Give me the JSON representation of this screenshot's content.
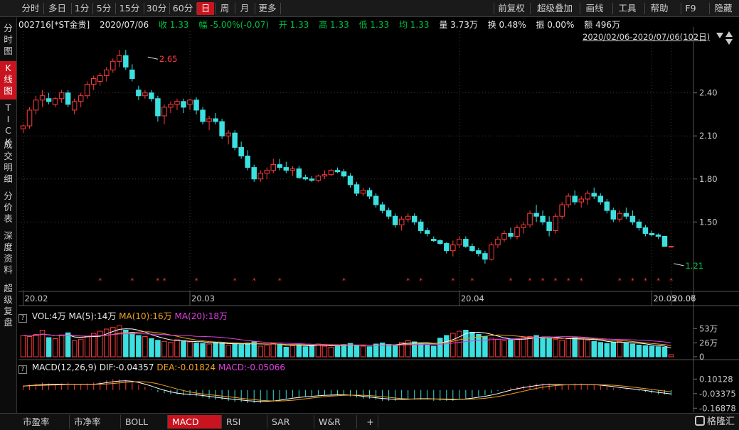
{
  "toolbar": {
    "left": [
      "分时",
      "多日",
      "1分",
      "5分",
      "15分",
      "30分",
      "60分",
      "日",
      "周",
      "月",
      "更多"
    ],
    "right": [
      "前复权",
      "超级叠加",
      "画线",
      "工具",
      "帮助",
      "F9",
      "隐藏"
    ]
  },
  "info": {
    "code": "002716[*ST金贵]",
    "date": "2020/07/06",
    "close": "收 1.33",
    "change": "幅 -5.00%(-0.07)",
    "open": "开 1.33",
    "high": "高 1.33",
    "low": "低 1.33",
    "avg": "均 1.33",
    "volume": "量 3.73万",
    "turnover": "换 0.48%",
    "amplitude": "振 0.00%",
    "amount": "额 496万"
  },
  "range_label": "2020/02/06-2020/07/06(102日)",
  "side_tabs": [
    "分时图",
    "K线图",
    "TICK",
    "成交明细",
    "分价表",
    "深度资料",
    "超级复盘"
  ],
  "vol_header": {
    "vol": "VOL:4万",
    "ma5": "MA(5):14万",
    "ma10": "MA(10):16万",
    "ma20": "MA(20):18万"
  },
  "macd_header": {
    "name": "MACD(12,26,9)",
    "dif": "DIF:-0.04357",
    "dea": "DEA:-0.01824",
    "macd": "MACD:-0.05066"
  },
  "bottom_tabs": [
    "市盈率",
    "市净率",
    "BOLL",
    "MACD",
    "RSI",
    "SAR",
    "W&R"
  ],
  "add_tab_label": "+",
  "logo_text": "格隆汇",
  "colors": {
    "up": "#ff3b3b",
    "down": "#3ce0e0",
    "ma5": "#ffffff",
    "ma10": "#f0a020",
    "ma20": "#e040e0",
    "grid": "#3a3a3a",
    "accent": "#c8141e"
  },
  "chart_data": [
    {
      "type": "candlestick",
      "x_tick_labels": [
        "20.02",
        "20.03",
        "20.04",
        "20.05",
        "20.06",
        "20.07"
      ],
      "y_tick_labels": [
        "2.40",
        "2.10",
        "1.80",
        "1.50"
      ],
      "y_ticks": [
        2.4,
        2.1,
        1.8,
        1.5
      ],
      "ylim": [
        1.12,
        2.78
      ],
      "grid": true,
      "annotations": [
        {
          "label": "2.65",
          "value": 2.65,
          "day": 19
        },
        {
          "label": "1.21",
          "value": 1.21,
          "day": 106
        }
      ],
      "tick_days": [
        0,
        26,
        68,
        98,
        125,
        157
      ],
      "ohlc": [
        [
          2.15,
          2.18,
          2.12,
          2.17
        ],
        [
          2.17,
          2.3,
          2.15,
          2.28
        ],
        [
          2.28,
          2.38,
          2.25,
          2.35
        ],
        [
          2.35,
          2.42,
          2.3,
          2.38
        ],
        [
          2.36,
          2.4,
          2.32,
          2.34
        ],
        [
          2.32,
          2.37,
          2.3,
          2.36
        ],
        [
          2.36,
          2.42,
          2.33,
          2.4
        ],
        [
          2.4,
          2.42,
          2.3,
          2.32
        ],
        [
          2.28,
          2.36,
          2.25,
          2.34
        ],
        [
          2.34,
          2.4,
          2.3,
          2.38
        ],
        [
          2.38,
          2.48,
          2.36,
          2.46
        ],
        [
          2.46,
          2.52,
          2.42,
          2.5
        ],
        [
          2.48,
          2.54,
          2.45,
          2.52
        ],
        [
          2.52,
          2.58,
          2.48,
          2.56
        ],
        [
          2.56,
          2.64,
          2.54,
          2.62
        ],
        [
          2.62,
          2.7,
          2.58,
          2.66
        ],
        [
          2.66,
          2.7,
          2.56,
          2.58
        ],
        [
          2.56,
          2.6,
          2.48,
          2.5
        ],
        [
          2.42,
          2.45,
          2.35,
          2.38
        ],
        [
          2.38,
          2.42,
          2.36,
          2.4
        ],
        [
          2.4,
          2.42,
          2.34,
          2.36
        ],
        [
          2.36,
          2.38,
          2.2,
          2.24
        ],
        [
          2.24,
          2.32,
          2.18,
          2.3
        ],
        [
          2.3,
          2.34,
          2.26,
          2.32
        ],
        [
          2.32,
          2.36,
          2.28,
          2.34
        ],
        [
          2.34,
          2.36,
          2.26,
          2.3
        ],
        [
          2.32,
          2.36,
          2.28,
          2.35
        ],
        [
          2.35,
          2.37,
          2.25,
          2.28
        ],
        [
          2.28,
          2.3,
          2.18,
          2.2
        ],
        [
          2.2,
          2.24,
          2.14,
          2.22
        ],
        [
          2.22,
          2.26,
          2.18,
          2.2
        ],
        [
          2.2,
          2.22,
          2.08,
          2.1
        ],
        [
          2.1,
          2.14,
          2.04,
          2.12
        ],
        [
          2.12,
          2.14,
          2.0,
          2.02
        ],
        [
          2.02,
          2.06,
          1.94,
          1.96
        ],
        [
          1.96,
          2.0,
          1.86,
          1.88
        ],
        [
          1.88,
          1.9,
          1.78,
          1.8
        ],
        [
          1.8,
          1.86,
          1.78,
          1.84
        ],
        [
          1.84,
          1.88,
          1.8,
          1.86
        ],
        [
          1.86,
          1.94,
          1.84,
          1.9
        ],
        [
          1.9,
          1.94,
          1.86,
          1.88
        ],
        [
          1.88,
          1.92,
          1.84,
          1.86
        ],
        [
          1.86,
          1.89,
          1.82,
          1.87
        ],
        [
          1.87,
          1.89,
          1.8,
          1.81
        ],
        [
          1.81,
          1.83,
          1.79,
          1.8
        ],
        [
          1.8,
          1.82,
          1.78,
          1.79
        ],
        [
          1.79,
          1.83,
          1.78,
          1.82
        ],
        [
          1.82,
          1.86,
          1.8,
          1.83
        ],
        [
          1.83,
          1.87,
          1.82,
          1.86
        ],
        [
          1.86,
          1.88,
          1.84,
          1.85
        ],
        [
          1.85,
          1.87,
          1.81,
          1.82
        ],
        [
          1.82,
          1.84,
          1.74,
          1.76
        ],
        [
          1.76,
          1.78,
          1.68,
          1.7
        ],
        [
          1.7,
          1.74,
          1.68,
          1.72
        ],
        [
          1.72,
          1.74,
          1.66,
          1.68
        ],
        [
          1.68,
          1.7,
          1.6,
          1.62
        ],
        [
          1.62,
          1.64,
          1.56,
          1.58
        ],
        [
          1.58,
          1.6,
          1.52,
          1.54
        ],
        [
          1.54,
          1.56,
          1.46,
          1.48
        ],
        [
          1.48,
          1.54,
          1.44,
          1.52
        ],
        [
          1.52,
          1.56,
          1.5,
          1.54
        ],
        [
          1.54,
          1.56,
          1.48,
          1.5
        ],
        [
          1.5,
          1.52,
          1.42,
          1.44
        ],
        [
          1.44,
          1.46,
          1.4,
          1.42
        ],
        [
          1.38,
          1.4,
          1.36,
          1.37
        ],
        [
          1.37,
          1.38,
          1.34,
          1.35
        ],
        [
          1.35,
          1.36,
          1.28,
          1.3
        ],
        [
          1.3,
          1.37,
          1.26,
          1.34
        ],
        [
          1.34,
          1.4,
          1.32,
          1.38
        ],
        [
          1.38,
          1.4,
          1.32,
          1.33
        ],
        [
          1.33,
          1.35,
          1.29,
          1.3
        ],
        [
          1.3,
          1.32,
          1.26,
          1.28
        ],
        [
          1.28,
          1.3,
          1.21,
          1.24
        ],
        [
          1.24,
          1.36,
          1.23,
          1.34
        ],
        [
          1.34,
          1.4,
          1.32,
          1.38
        ],
        [
          1.38,
          1.44,
          1.36,
          1.42
        ],
        [
          1.42,
          1.46,
          1.38,
          1.4
        ],
        [
          1.4,
          1.48,
          1.38,
          1.46
        ],
        [
          1.46,
          1.5,
          1.42,
          1.48
        ],
        [
          1.48,
          1.58,
          1.46,
          1.56
        ],
        [
          1.56,
          1.62,
          1.5,
          1.54
        ],
        [
          1.54,
          1.58,
          1.48,
          1.5
        ],
        [
          1.5,
          1.54,
          1.4,
          1.44
        ],
        [
          1.44,
          1.56,
          1.42,
          1.54
        ],
        [
          1.54,
          1.64,
          1.52,
          1.62
        ],
        [
          1.62,
          1.7,
          1.6,
          1.68
        ],
        [
          1.68,
          1.72,
          1.62,
          1.64
        ],
        [
          1.64,
          1.68,
          1.6,
          1.66
        ],
        [
          1.66,
          1.72,
          1.62,
          1.7
        ],
        [
          1.7,
          1.74,
          1.66,
          1.68
        ],
        [
          1.68,
          1.7,
          1.62,
          1.64
        ],
        [
          1.64,
          1.66,
          1.56,
          1.58
        ],
        [
          1.58,
          1.6,
          1.5,
          1.52
        ],
        [
          1.52,
          1.58,
          1.5,
          1.56
        ],
        [
          1.56,
          1.6,
          1.52,
          1.54
        ],
        [
          1.54,
          1.58,
          1.48,
          1.5
        ],
        [
          1.5,
          1.52,
          1.44,
          1.46
        ],
        [
          1.46,
          1.48,
          1.4,
          1.42
        ],
        [
          1.42,
          1.44,
          1.4,
          1.41
        ],
        [
          1.41,
          1.42,
          1.38,
          1.4
        ],
        [
          1.4,
          1.4,
          1.33,
          1.33
        ],
        [
          1.33,
          1.33,
          1.33,
          1.33
        ]
      ]
    },
    {
      "type": "bar",
      "name": "VOL",
      "y_tick_labels": [
        "53万",
        "26万",
        "0"
      ],
      "ylim": [
        0,
        60
      ],
      "values": [
        40,
        38,
        42,
        50,
        36,
        34,
        41,
        45,
        30,
        33,
        38,
        44,
        48,
        52,
        55,
        58,
        50,
        46,
        40,
        38,
        34,
        31,
        29,
        27,
        32,
        30,
        28,
        26,
        25,
        24,
        27,
        26,
        22,
        24,
        23,
        26,
        28,
        20,
        22,
        25,
        24,
        18,
        21,
        23,
        19,
        22,
        24,
        20,
        18,
        21,
        23,
        25,
        22,
        20,
        19,
        24,
        26,
        23,
        21,
        27,
        30,
        28,
        25,
        22,
        20,
        35,
        40,
        44,
        48,
        50,
        46,
        42,
        38,
        35,
        33,
        30,
        32,
        34,
        36,
        38,
        40,
        37,
        35,
        33,
        31,
        34,
        36,
        33,
        31,
        29,
        27,
        25,
        27,
        29,
        26,
        24,
        22,
        21,
        20,
        19,
        18,
        4
      ]
    },
    {
      "type": "bar",
      "name": "MACD",
      "y_tick_labels": [
        "0.10128",
        "-0.03375",
        "-0.16878"
      ],
      "ylim": [
        -0.18,
        0.11
      ],
      "values": [
        0.04,
        0.05,
        0.06,
        0.07,
        0.06,
        0.05,
        0.06,
        0.07,
        0.05,
        0.05,
        0.06,
        0.07,
        0.08,
        0.09,
        0.1,
        0.1,
        0.09,
        0.07,
        0.05,
        0.03,
        0.01,
        -0.02,
        -0.03,
        -0.04,
        -0.04,
        -0.05,
        -0.05,
        -0.06,
        -0.07,
        -0.08,
        -0.09,
        -0.09,
        -0.1,
        -0.11,
        -0.11,
        -0.12,
        -0.12,
        -0.12,
        -0.11,
        -0.1,
        -0.09,
        -0.08,
        -0.07,
        -0.07,
        -0.06,
        -0.06,
        -0.05,
        -0.05,
        -0.05,
        -0.05,
        -0.05,
        -0.06,
        -0.07,
        -0.08,
        -0.08,
        -0.09,
        -0.1,
        -0.1,
        -0.1,
        -0.09,
        -0.09,
        -0.09,
        -0.09,
        -0.09,
        -0.1,
        -0.1,
        -0.1,
        -0.1,
        -0.09,
        -0.08,
        -0.07,
        -0.06,
        -0.05,
        -0.03,
        -0.01,
        0.01,
        0.02,
        0.03,
        0.04,
        0.05,
        0.06,
        0.06,
        0.06,
        0.05,
        0.05,
        0.05,
        0.06,
        0.06,
        0.05,
        0.05,
        0.04,
        0.03,
        0.02,
        0.01,
        0.01,
        0.0,
        -0.01,
        -0.02,
        -0.03,
        -0.04,
        -0.04,
        -0.05
      ]
    }
  ]
}
